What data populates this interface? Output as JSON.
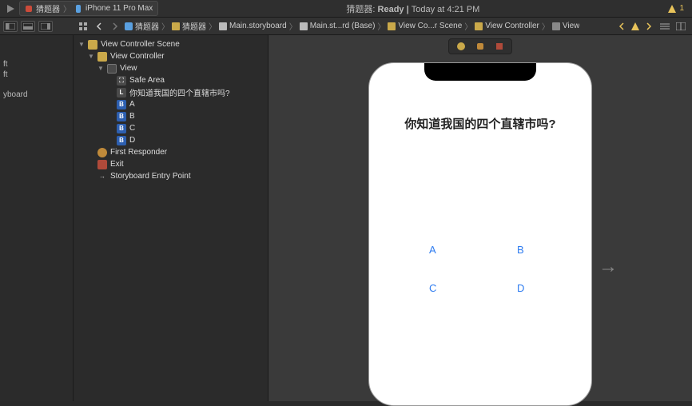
{
  "titlebar": {
    "scheme_app_name": "猜题器",
    "scheme_device": "iPhone 11 Pro Max",
    "status_prefix": "猜题器: ",
    "status_state": "Ready | ",
    "status_time": "Today at 4:21 PM",
    "warning_count": "1"
  },
  "breadcrumbs": [
    "猜题器",
    "猜题器",
    "Main.storyboard",
    "Main.st...rd (Base)",
    "View Co...r Scene",
    "View Controller",
    "View"
  ],
  "file_nav": {
    "item1": "ft",
    "item2": "ft",
    "item3": "yboard"
  },
  "outline": {
    "scene": "View Controller Scene",
    "vc": "View Controller",
    "view": "View",
    "safe": "Safe Area",
    "label": "你知道我国的四个直辖市吗?",
    "btnA": "A",
    "btnB": "B",
    "btnC": "C",
    "btnD": "D",
    "first_responder": "First Responder",
    "exit": "Exit",
    "entry": "Storyboard Entry Point"
  },
  "device": {
    "question": "你知道我国的四个直辖市吗?",
    "answerA": "A",
    "answerB": "B",
    "answerC": "C",
    "answerD": "D"
  }
}
